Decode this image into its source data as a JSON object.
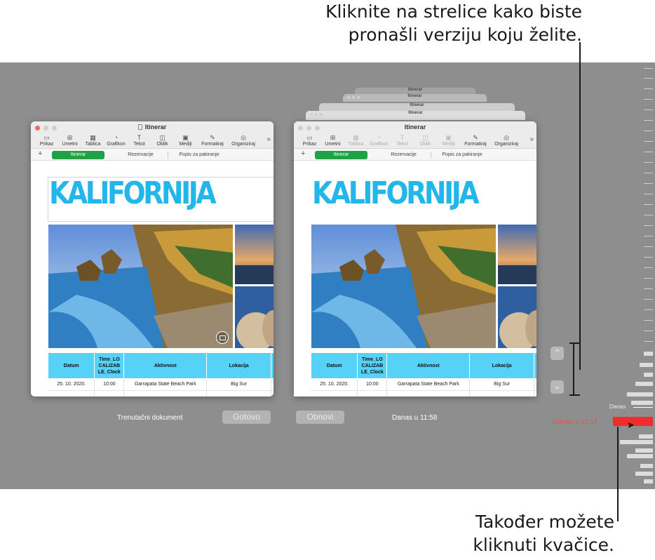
{
  "callouts": {
    "top_line1": "Kliknite na strelice kako biste",
    "top_line2": "pronašli verziju koju želite.",
    "bottom_line1": "Također možete",
    "bottom_line2": "kliknuti kvačice."
  },
  "window": {
    "title": "Itinerar",
    "toolbar": [
      "Prikaz",
      "Umetni",
      "Tablica",
      "Grafikon",
      "Tekst",
      "Oblik",
      "Mediji",
      "Formatiraj",
      "Organiziraj"
    ],
    "tabs": [
      "Itinerar",
      "Rezervacije",
      "Popis za pakiranje"
    ],
    "heading": "KALIFORNIJA",
    "table": {
      "headers": [
        "Datum",
        "Time_LO CALIZAB LE_Clock",
        "Aktivnost",
        "Lokacija"
      ],
      "row": [
        "25. 10. 2020.",
        "10:00",
        "Garrapata State Beach Park",
        "Big Sur"
      ]
    }
  },
  "stack_titles": [
    "Itinerar",
    "Itinerar",
    "Itinerar",
    "Itinerar"
  ],
  "bottom": {
    "current_caption": "Trenutačni dokument",
    "done_button": "Gotovo",
    "restore_button": "Obnovi",
    "version_caption": "Danas u 11:58"
  },
  "timeline": {
    "today_label": "Danas",
    "now_label": "Danas u 11:17"
  },
  "colors": {
    "accent_blue": "#23b6e8",
    "table_header": "#56d2f6",
    "active_tab": "#1fa146",
    "timeline_now": "#f02c2c"
  },
  "icons": {
    "up": "chevron-up-icon",
    "down": "chevron-down-icon"
  }
}
